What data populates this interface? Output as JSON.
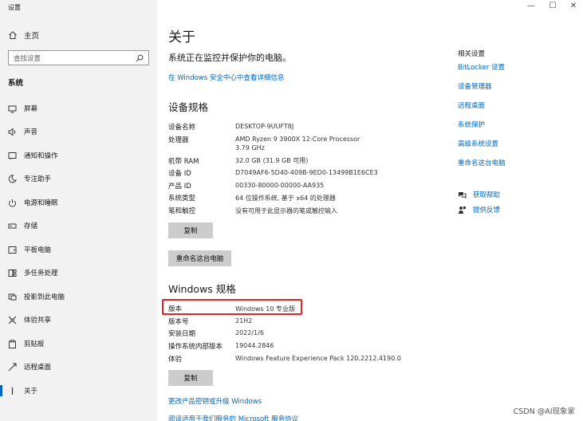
{
  "window": {
    "title": "设置",
    "minimize": "—",
    "maximize": "☐",
    "close": "✕"
  },
  "sidebar": {
    "home_label": "主页",
    "search_placeholder": "查找设置",
    "section": "系统",
    "items": [
      {
        "label": "屏幕",
        "icon": "monitor-icon"
      },
      {
        "label": "声音",
        "icon": "speaker-icon"
      },
      {
        "label": "通知和操作",
        "icon": "notification-icon"
      },
      {
        "label": "专注助手",
        "icon": "moon-icon"
      },
      {
        "label": "电源和睡眠",
        "icon": "power-icon"
      },
      {
        "label": "存储",
        "icon": "storage-icon"
      },
      {
        "label": "平板电脑",
        "icon": "tablet-icon"
      },
      {
        "label": "多任务处理",
        "icon": "multitask-icon"
      },
      {
        "label": "投影到此电脑",
        "icon": "project-icon"
      },
      {
        "label": "体验共享",
        "icon": "share-icon"
      },
      {
        "label": "剪贴板",
        "icon": "clipboard-icon"
      },
      {
        "label": "远程桌面",
        "icon": "remote-icon"
      },
      {
        "label": "关于",
        "icon": "info-icon"
      }
    ]
  },
  "main": {
    "title": "关于",
    "protect_text": "系统正在监控并保护你的电脑。",
    "security_link": "在 Windows 安全中心中查看详细信息",
    "device_spec_title": "设备规格",
    "device_specs": [
      {
        "label": "设备名称",
        "value": "DESKTOP-9UUFT8J"
      },
      {
        "label": "处理器",
        "value": "AMD Ryzen 9 3900X 12-Core Processor",
        "value2": "3.79 GHz"
      },
      {
        "label": "机带 RAM",
        "value": "32.0 GB (31.9 GB 可用)"
      },
      {
        "label": "设备 ID",
        "value": "D7049AF6-5D40-409B-9ED0-13499B1E6CE3"
      },
      {
        "label": "产品 ID",
        "value": "00330-80000-00000-AA935"
      },
      {
        "label": "系统类型",
        "value": "64 位操作系统, 基于 x64 的处理器"
      },
      {
        "label": "笔和触控",
        "value": "没有可用于此显示器的笔或触控输入"
      }
    ],
    "copy_button": "复制",
    "rename_button": "重命名这台电脑",
    "windows_spec_title": "Windows 规格",
    "windows_specs": [
      {
        "label": "版本",
        "value": "Windows 10 专业版"
      },
      {
        "label": "版本号",
        "value": "21H2"
      },
      {
        "label": "安装日期",
        "value": "2022/1/6"
      },
      {
        "label": "操作系统内部版本",
        "value": "19044.2846"
      },
      {
        "label": "体验",
        "value": "Windows Feature Experience Pack 120.2212.4190.0"
      }
    ],
    "copy_button2": "复制",
    "link_upgrade": "更改产品密钥或升级 Windows",
    "link_agreement": "阅读适用于我们服务的 Microsoft 服务协议"
  },
  "related": {
    "title": "相关设置",
    "links": [
      "BitLocker 设置",
      "设备管理器",
      "远程桌面",
      "系统保护",
      "高级系统设置",
      "重命名这台电脑"
    ],
    "help": "获取帮助",
    "feedback": "提供反馈"
  },
  "watermark": "CSDN @AI现象家",
  "colors": {
    "accent": "#0067c0",
    "highlight": "#e02424"
  }
}
